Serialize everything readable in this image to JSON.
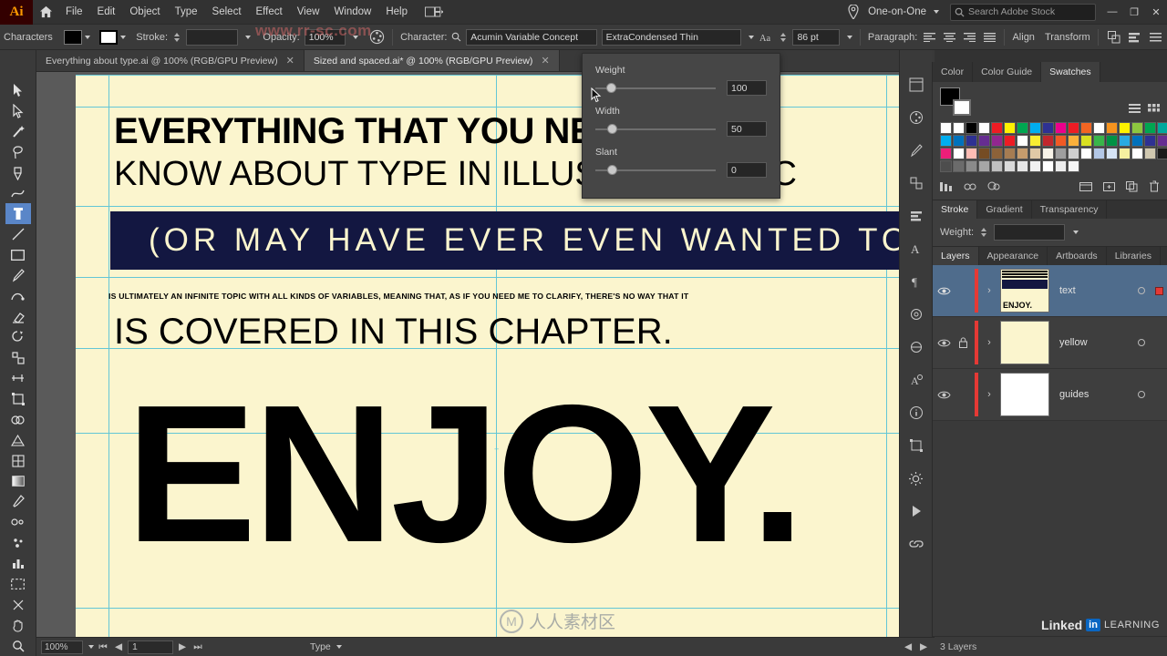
{
  "app": {
    "logo": "Ai",
    "menus": [
      "File",
      "Edit",
      "Object",
      "Type",
      "Select",
      "Effect",
      "View",
      "Window",
      "Help"
    ],
    "workspace": "One-on-One",
    "search_placeholder": "Search Adobe Stock",
    "win_min": "—",
    "win_max": "❐",
    "win_close": "✕"
  },
  "control_bar": {
    "characters_label": "Characters",
    "stroke_label": "Stroke:",
    "stroke_weight": "",
    "opacity_label": "Opacity:",
    "opacity_value": "100%",
    "character_label": "Character:",
    "font_family": "Acumin Variable Concept",
    "font_style": "ExtraCondensed Thin",
    "font_size": "86 pt",
    "paragraph_label": "Paragraph:",
    "align_label": "Align",
    "transform_label": "Transform"
  },
  "tabs": [
    {
      "label": "Everything about type.ai @ 100% (RGB/GPU Preview)",
      "close": "✕",
      "active": false
    },
    {
      "label": "Sized and spaced.ai* @ 100% (RGB/GPU Preview)",
      "close": "✕",
      "active": true
    }
  ],
  "toolbar": {
    "tools": [
      {
        "name": "selection-tool",
        "glyph": "↖"
      },
      {
        "name": "direct-selection-tool",
        "glyph": "↗"
      },
      {
        "name": "magic-wand-tool",
        "glyph": "✦"
      },
      {
        "name": "lasso-tool",
        "glyph": "❀"
      },
      {
        "name": "pen-tool",
        "glyph": "✒"
      },
      {
        "name": "curvature-tool",
        "glyph": "∿"
      },
      {
        "name": "type-tool",
        "glyph": "T",
        "selected": true
      },
      {
        "name": "line-segment-tool",
        "glyph": "╱"
      },
      {
        "name": "rectangle-tool",
        "glyph": "▭"
      },
      {
        "name": "paintbrush-tool",
        "glyph": "✎"
      },
      {
        "name": "shaper-tool",
        "glyph": "◡"
      },
      {
        "name": "eraser-tool",
        "glyph": "⌫"
      },
      {
        "name": "rotate-tool",
        "glyph": "↻"
      },
      {
        "name": "scale-tool",
        "glyph": "⤡"
      },
      {
        "name": "width-tool",
        "glyph": "⧉"
      },
      {
        "name": "free-transform-tool",
        "glyph": "⌗"
      },
      {
        "name": "shape-builder-tool",
        "glyph": "◑"
      },
      {
        "name": "perspective-grid-tool",
        "glyph": "▦"
      },
      {
        "name": "mesh-tool",
        "glyph": "⌸"
      },
      {
        "name": "gradient-tool",
        "glyph": "▤"
      },
      {
        "name": "eyedropper-tool",
        "glyph": "⚗"
      },
      {
        "name": "blend-tool",
        "glyph": "⚭"
      },
      {
        "name": "symbol-sprayer-tool",
        "glyph": "⁂"
      },
      {
        "name": "column-graph-tool",
        "glyph": "Ὄa"
      },
      {
        "name": "artboard-tool",
        "glyph": "⬚"
      },
      {
        "name": "slice-tool",
        "glyph": "✂"
      },
      {
        "name": "hand-tool",
        "glyph": "✋"
      },
      {
        "name": "zoom-tool",
        "glyph": "⌕"
      }
    ]
  },
  "artwork": {
    "headline_line1": "EVERYTHING THAT YOU NEED TO",
    "headline_line2": "KNOW ABOUT TYPE IN ILLUSTRATOR CC",
    "navy_band_text": "(OR MAY HAVE EVER EVEN WANTED TO KNOW)",
    "fine_print": "IS ULTIMATELY AN INFINITE TOPIC WITH ALL KINDS OF VARIABLES, MEANING THAT, AS IF YOU NEED ME TO CLARIFY, THERE'S NO WAY THAT IT",
    "headline_line3": "IS COVERED IN THIS CHAPTER.",
    "big_word": "ENJOY.",
    "background_color": "#fbf5ce",
    "band_color": "#131741"
  },
  "variable_font_panel": {
    "weight_label": "Weight",
    "weight_value": "100",
    "width_label": "Width",
    "width_value": "50",
    "slant_label": "Slant",
    "slant_value": "0"
  },
  "right_dock": {
    "color_tabs": [
      {
        "label": "Color",
        "active": false
      },
      {
        "label": "Color Guide",
        "active": false
      },
      {
        "label": "Swatches",
        "active": true
      }
    ],
    "swatch_rows": [
      [
        "#ffffff",
        "#ffffff",
        "#000000",
        "#ffffff",
        "#ed1c24",
        "#fff200",
        "#00a651",
        "#00aeef",
        "#2e3192",
        "#ec008c",
        "#ed1c24",
        "#f26522",
        "#ffffff"
      ],
      [
        "#f7941e",
        "#fff200",
        "#8dc63f",
        "#00a651",
        "#00a99d",
        "#00aeef",
        "#0072bc",
        "#2e3192",
        "#662d91",
        "#92278f",
        "#ed1c24",
        "#ffffff",
        "#f9ed32"
      ],
      [
        "#c1272d",
        "#f15a24",
        "#fbb03b",
        "#d9e021",
        "#39b54a",
        "#009245",
        "#29abe2",
        "#0071bc",
        "#2e3192",
        "#662d91",
        "#ed1e79",
        "#ffffff",
        "#fdbcb4"
      ],
      [
        "#754c24",
        "#8c6239",
        "#a67c52",
        "#c69c6d",
        "#e0c9a6",
        "#f7f3e8",
        "#9e9e9e",
        "#cfcfcf",
        "#ffffff",
        "#b3c7e6",
        "#d6e4f5",
        "#f6f0a0",
        "#ffffff"
      ],
      [
        "#d0c8b0",
        "#1a1a1a",
        "#4d4d4d",
        "#6b6b6b",
        "#8a8a8a",
        "#a6a6a6",
        "#bfbfbf",
        "#d9d9d9",
        "#e6e6e6",
        "#f2f2f2",
        "#ffffff",
        "#ededed",
        "#f5f5f5"
      ]
    ],
    "stroke_tabs": [
      {
        "label": "Stroke",
        "active": true
      },
      {
        "label": "Gradient",
        "active": false
      },
      {
        "label": "Transparency",
        "active": false
      }
    ],
    "stroke_weight_label": "Weight:",
    "stroke_weight_value": "",
    "layer_tabs": [
      {
        "label": "Layers",
        "active": true
      },
      {
        "label": "Appearance",
        "active": false
      },
      {
        "label": "Artboards",
        "active": false
      },
      {
        "label": "Libraries",
        "active": false
      }
    ],
    "layers": [
      {
        "name": "text",
        "visible": true,
        "locked": false,
        "selected": true,
        "thumb_text": "ENJOY."
      },
      {
        "name": "yellow",
        "visible": true,
        "locked": true,
        "selected": false,
        "thumb_text": ""
      },
      {
        "name": "guides",
        "visible": true,
        "locked": false,
        "selected": false,
        "thumb_text": ""
      }
    ],
    "layers_count": "3 Layers",
    "brand_name": "Linked",
    "brand_badge": "in",
    "brand_sub": "LEARNING"
  },
  "status_bar": {
    "zoom": "100%",
    "page": "1",
    "tool": "Type"
  },
  "watermarks": {
    "top": "www.rr-sc.com",
    "bottom_cn": "人人素材区",
    "right": ""
  }
}
